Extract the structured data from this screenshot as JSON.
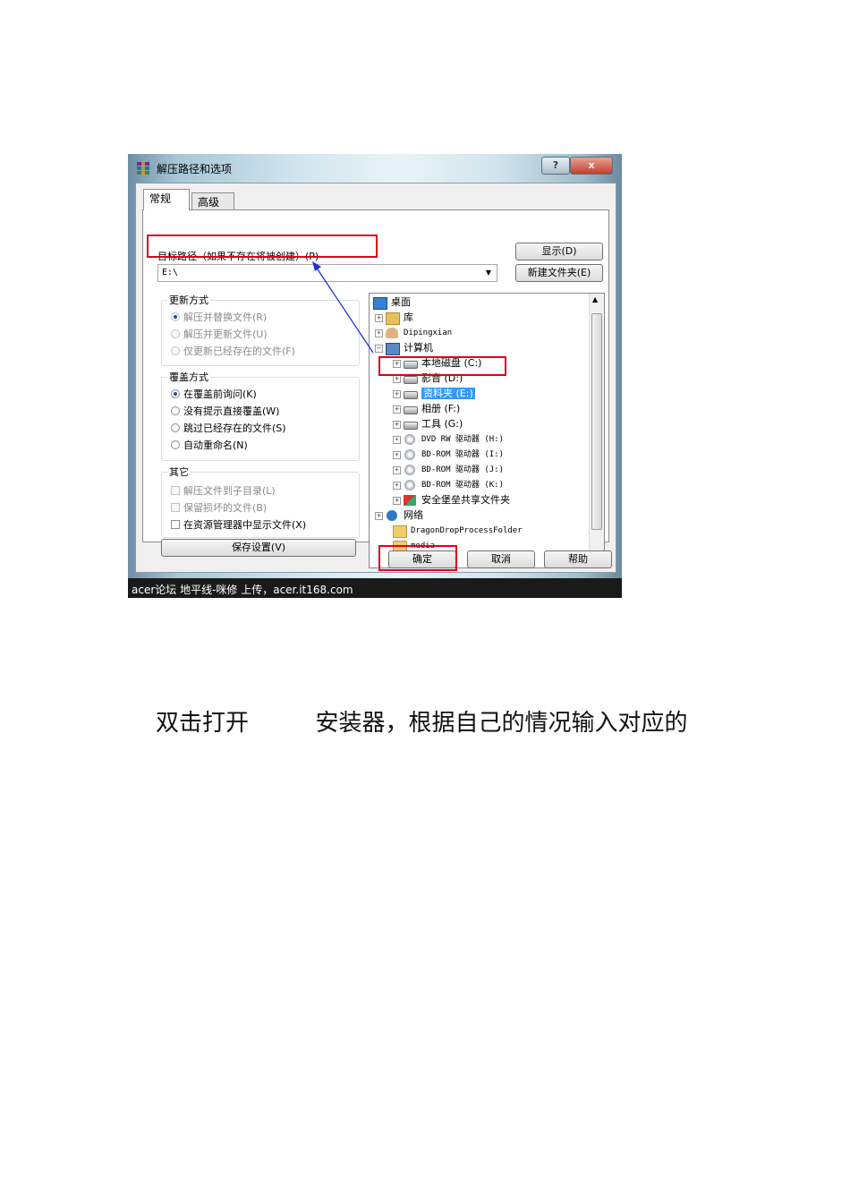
{
  "dialog": {
    "title": "解压路径和选项",
    "help_glyph": "?",
    "close_glyph": "x",
    "tabs": [
      "常规",
      "高级"
    ],
    "target_label": "目标路径（如果不存在将被创建）(P)",
    "target_value": "E:\\",
    "show_button": "显示(D)",
    "new_folder_button": "新建文件夹(E)",
    "update_group": {
      "title": "更新方式",
      "options": [
        "解压并替换文件(R)",
        "解压并更新文件(U)",
        "仅更新已经存在的文件(F)"
      ]
    },
    "overwrite_group": {
      "title": "覆盖方式",
      "options": [
        "在覆盖前询问(K)",
        "没有提示直接覆盖(W)",
        "跳过已经存在的文件(S)",
        "自动重命名(N)"
      ]
    },
    "other_group": {
      "title": "其它",
      "options": [
        "解压文件到子目录(L)",
        "保留损坏的文件(B)",
        "在资源管理器中显示文件(X)"
      ]
    },
    "save_button": "保存设置(V)",
    "tree": [
      {
        "label": "桌面",
        "icon": "desktop-icon"
      },
      {
        "label": "库",
        "icon": "library-icon"
      },
      {
        "label": "Dipingxian",
        "icon": "user-icon"
      },
      {
        "label": "计算机",
        "icon": "computer-icon"
      },
      {
        "label": "本地磁盘 (C:)",
        "icon": "drive-icon"
      },
      {
        "label": "影音 (D:)",
        "icon": "drive-icon"
      },
      {
        "label": "资料夹 (E:)",
        "icon": "drive-icon"
      },
      {
        "label": "相册 (F:)",
        "icon": "drive-icon"
      },
      {
        "label": "工具 (G:)",
        "icon": "drive-icon"
      },
      {
        "label": "DVD RW 驱动器 (H:)",
        "icon": "cd-drive-icon"
      },
      {
        "label": "BD-ROM 驱动器 (I:)",
        "icon": "cd-drive-icon"
      },
      {
        "label": "BD-ROM 驱动器 (J:)",
        "icon": "cd-drive-icon"
      },
      {
        "label": "BD-ROM 驱动器 (K:)",
        "icon": "cd-drive-icon"
      },
      {
        "label": "安全堡垒共享文件夹",
        "icon": "shield-folder-icon"
      },
      {
        "label": "网络",
        "icon": "network-icon"
      },
      {
        "label": "DragonDropProcessFolder",
        "icon": "folder-icon"
      },
      {
        "label": "media",
        "icon": "folder-icon"
      }
    ],
    "ok_button": "确定",
    "cancel_button": "取消",
    "help_button": "帮助",
    "highlight_color": "#e0001b",
    "arrow_color": "#1f2fd0"
  },
  "footer": "acer论坛 地平线-咪修 上传，acer.it168.com",
  "caption": {
    "part1": "双击打开",
    "part2": "安装器，根据自己的情况输入对应的"
  }
}
